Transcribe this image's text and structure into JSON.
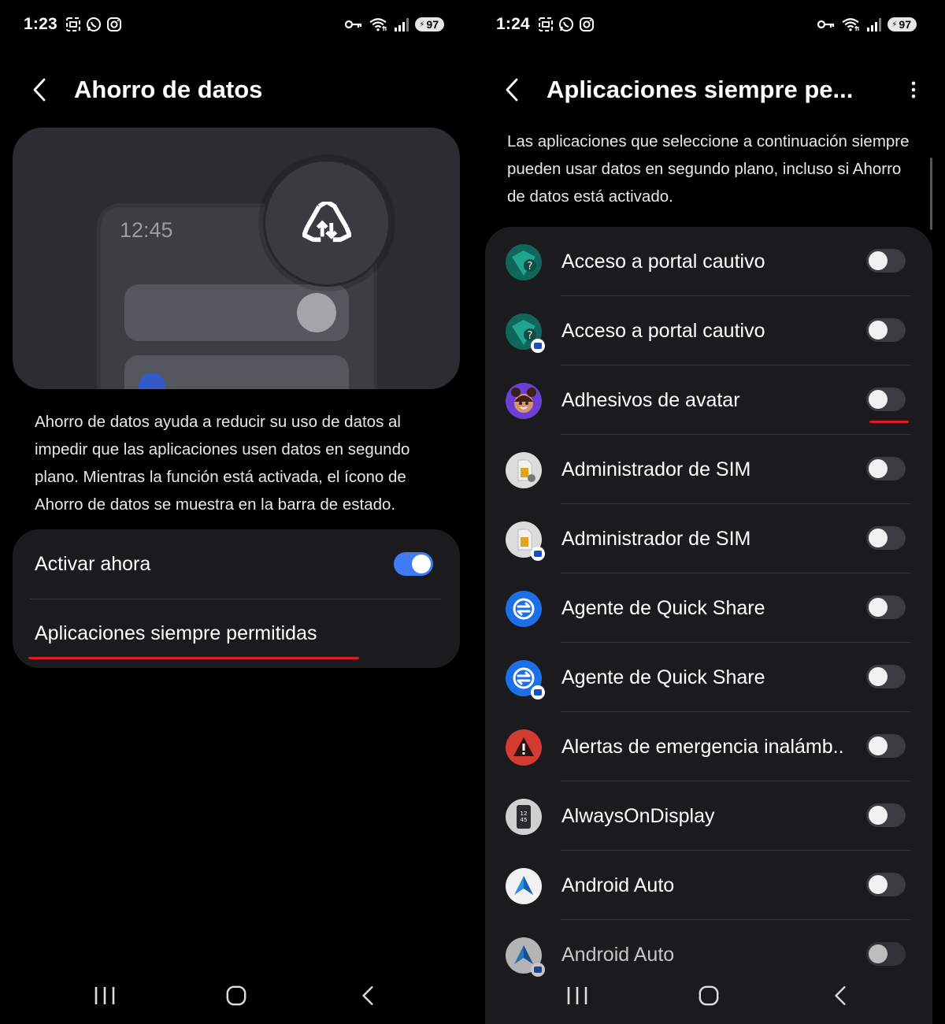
{
  "left": {
    "status": {
      "time": "1:23",
      "battery": "97"
    },
    "header": {
      "title": "Ahorro de datos"
    },
    "illustration": {
      "time": "12:45"
    },
    "description": "Ahorro de datos ayuda a reducir su uso de datos al impedir que las aplicaciones usen datos en segundo plano. Mientras la función está activada, el ícono de Ahorro de datos se muestra en la barra de estado.",
    "settings": {
      "activate_label": "Activar ahora",
      "activate_on": true,
      "always_allowed_label": "Aplicaciones siempre permitidas"
    }
  },
  "right": {
    "status": {
      "time": "1:24",
      "battery": "97"
    },
    "header": {
      "title": "Aplicaciones siempre pe..."
    },
    "description": "Las aplicaciones que seleccione a continuación siempre pueden usar datos en segundo plano, incluso si Ahorro de datos está activado.",
    "apps": [
      {
        "label": "Acceso a portal cautivo",
        "icon": "captive-portal-icon",
        "enabled": false
      },
      {
        "label": "Acceso a portal cautivo",
        "icon": "captive-portal-work-icon",
        "enabled": false
      },
      {
        "label": "Adhesivos de avatar",
        "icon": "avatar-stickers-icon",
        "enabled": false
      },
      {
        "label": "Administrador de SIM",
        "icon": "sim-manager-icon",
        "enabled": false
      },
      {
        "label": "Administrador de SIM",
        "icon": "sim-manager-work-icon",
        "enabled": false
      },
      {
        "label": "Agente de Quick Share",
        "icon": "quick-share-icon",
        "enabled": false
      },
      {
        "label": "Agente de Quick Share",
        "icon": "quick-share-work-icon",
        "enabled": false
      },
      {
        "label": "Alertas de emergencia inalámb..",
        "icon": "emergency-alert-icon",
        "enabled": false
      },
      {
        "label": "AlwaysOnDisplay",
        "icon": "always-on-display-icon",
        "enabled": false
      },
      {
        "label": "Android Auto",
        "icon": "android-auto-icon",
        "enabled": false
      },
      {
        "label": "Android Auto",
        "icon": "android-auto-work-icon",
        "enabled": false
      }
    ]
  },
  "colors": {
    "accent": "#3e7bf5",
    "highlight": "#e01b24",
    "card": "#1b1b1d"
  }
}
